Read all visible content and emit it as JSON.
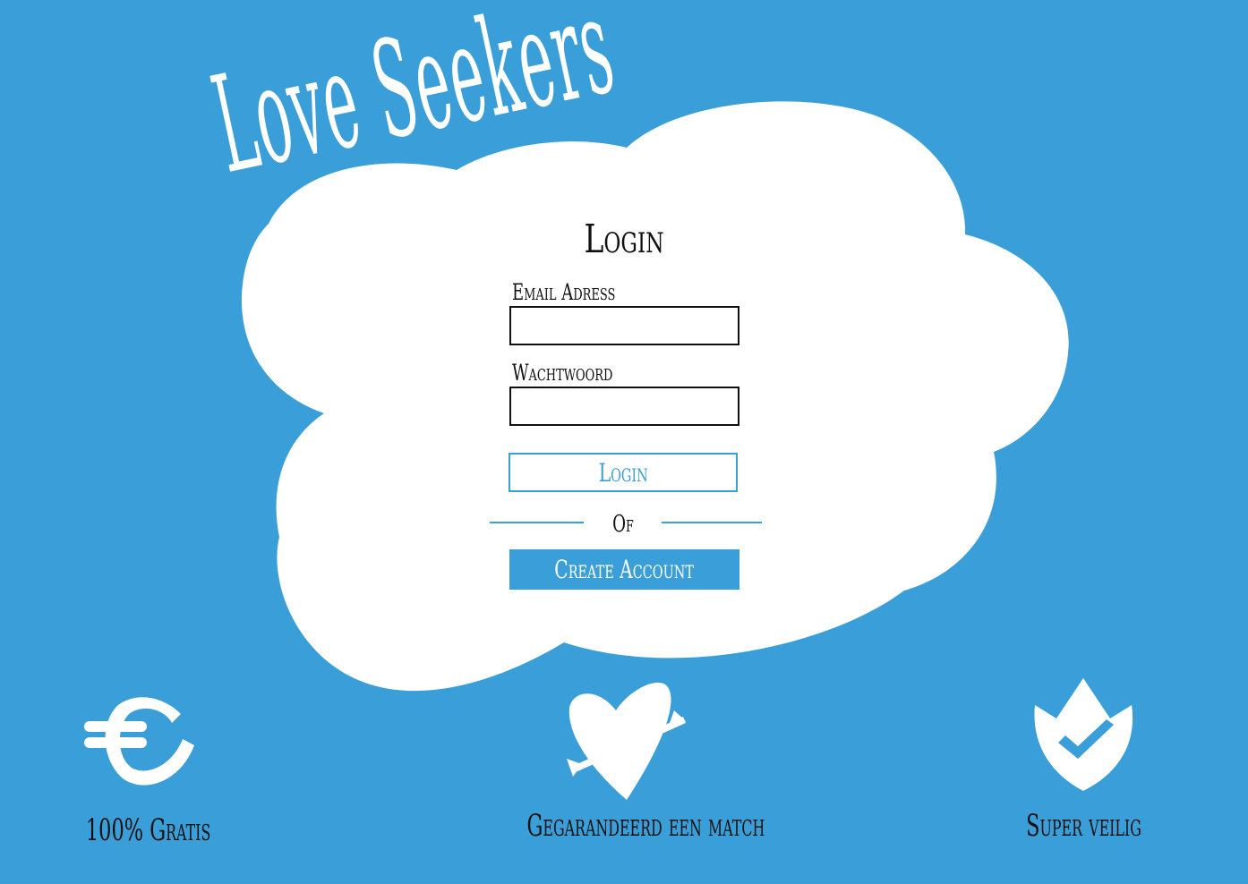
{
  "brand": {
    "name": "Love Seekers"
  },
  "colors": {
    "background": "#3a9fd8",
    "cloud": "#ffffff",
    "text": "#111111",
    "accent": "#3a9fd8"
  },
  "login": {
    "title": "Login",
    "email_label": "Email Adress",
    "email_value": "",
    "password_label": "Wachtwoord",
    "password_value": "",
    "login_button": "Login",
    "divider_text": "Of",
    "create_account_button": "Create Account"
  },
  "features": [
    {
      "icon": "euro-icon",
      "label": "100% Gratis"
    },
    {
      "icon": "heart-arrow-icon",
      "label": "Gegarandeerd een match"
    },
    {
      "icon": "shield-check-icon",
      "label": "Super veilig"
    }
  ]
}
